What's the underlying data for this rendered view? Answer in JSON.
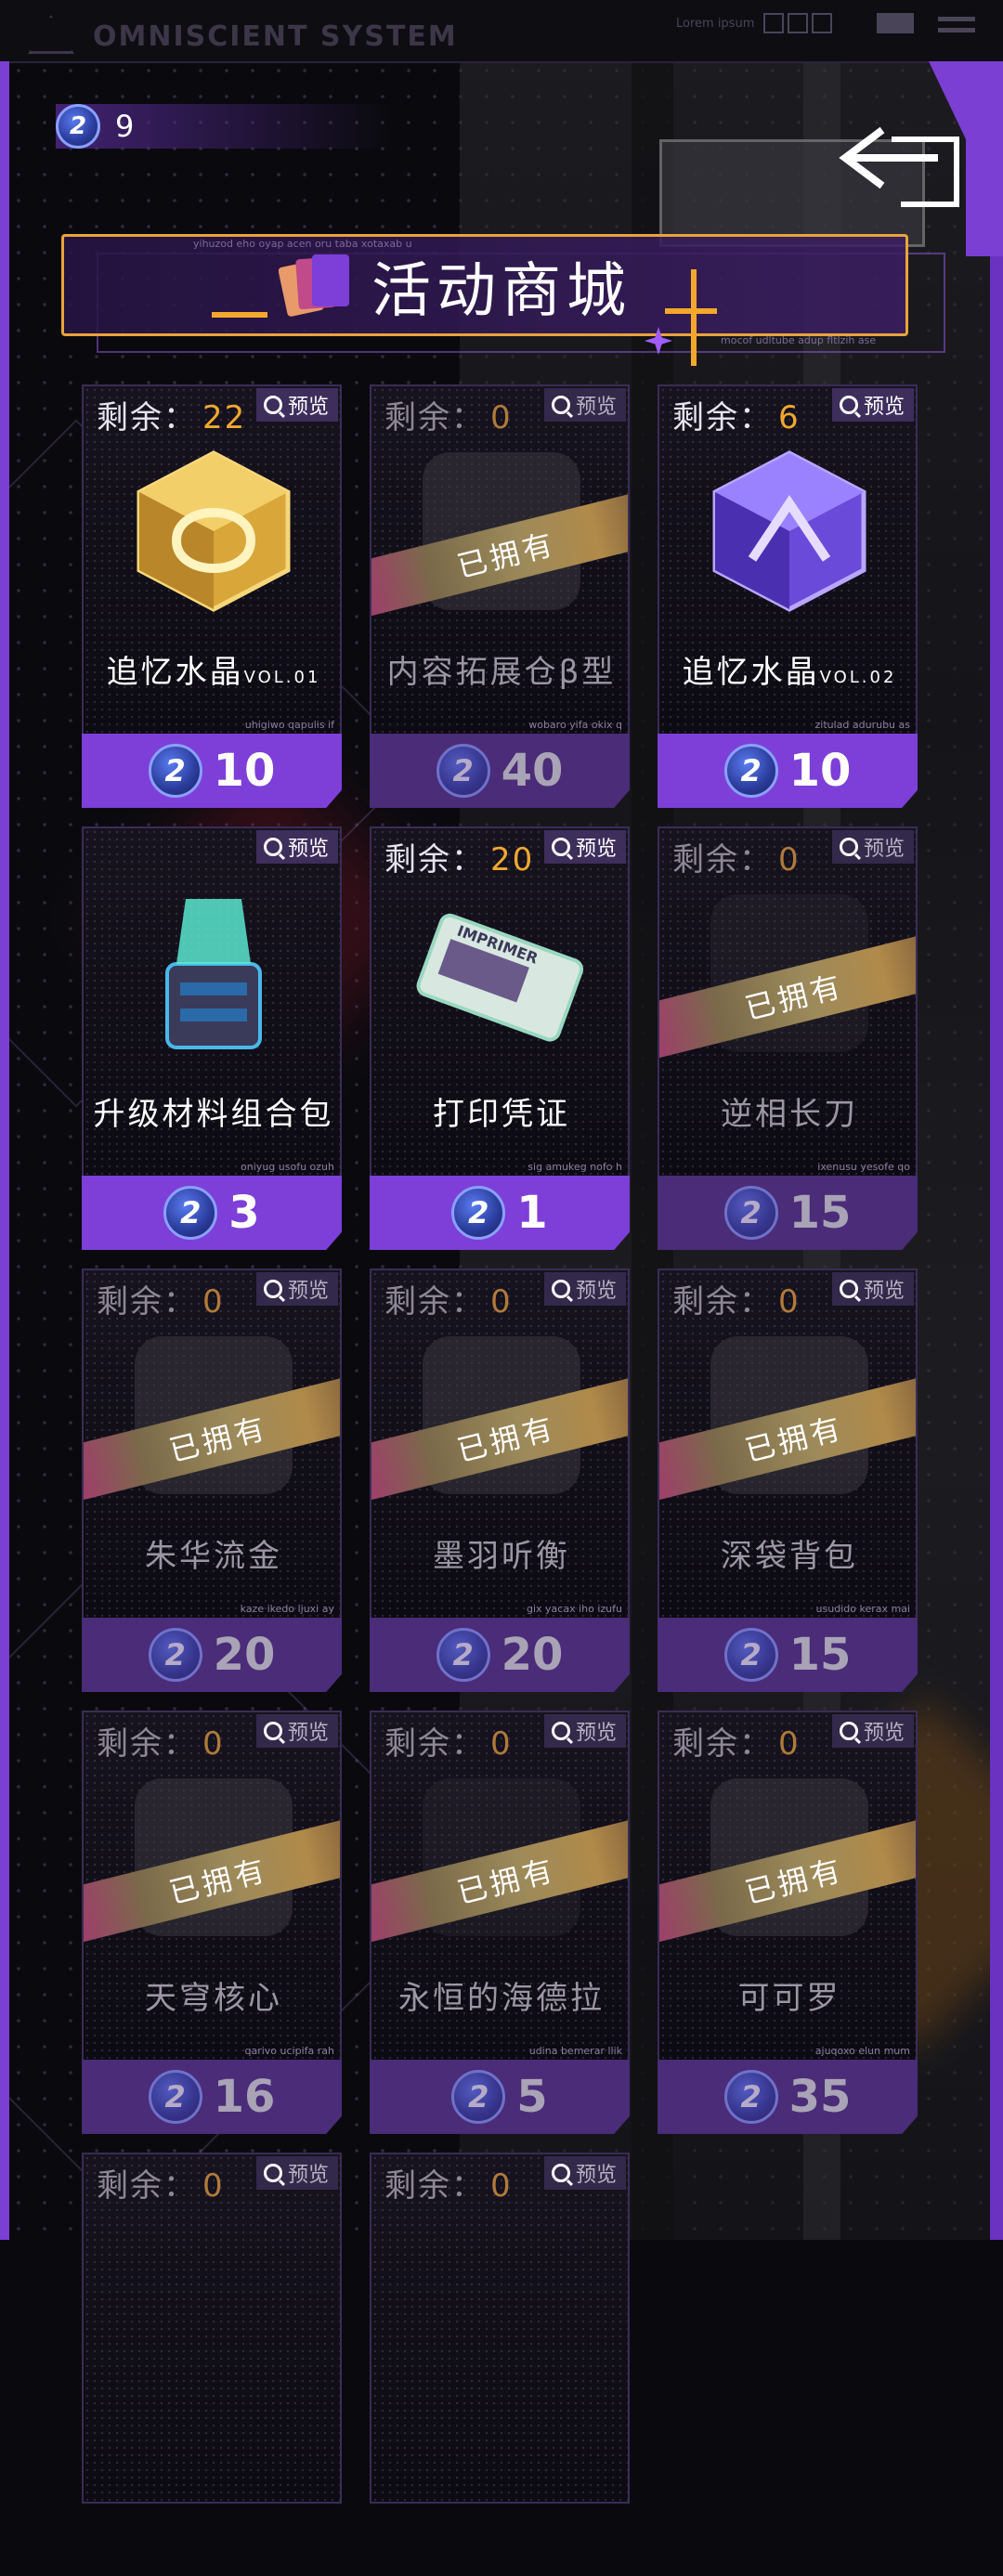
{
  "topbar": {
    "logo_text": "OMNISCIENT SYSTEM",
    "lorem": "Lorem ipsum"
  },
  "currency": {
    "icon": "gem-coin-icon",
    "amount": "9"
  },
  "title": {
    "text": "活动商城",
    "small_top": "yihuzod eho oyap acen oru taba xotaxab u",
    "small_bottom": "mocof udltube adup fltlzih ase"
  },
  "labels": {
    "remaining": "剩余：",
    "preview": "预览",
    "owned": "已拥有"
  },
  "items": [
    {
      "remaining": "22",
      "name": "追忆水晶",
      "vol": "VOL.01",
      "price": "10",
      "owned": false,
      "tiny": "uhigiwo qapulis if",
      "art": "gold-crystal-icon"
    },
    {
      "remaining": "0",
      "name": "内容拓展仓β型",
      "vol": "",
      "price": "40",
      "owned": true,
      "tiny": "wobaro yifa okix q",
      "art": "expansion-icon"
    },
    {
      "remaining": "6",
      "name": "追忆水晶",
      "vol": "VOL.02",
      "price": "10",
      "owned": false,
      "tiny": "zitulad adurubu as",
      "art": "purple-crystal-icon"
    },
    {
      "remaining": "",
      "name": "升级材料组合包",
      "vol": "",
      "price": "3",
      "owned": false,
      "tiny": "oniyug usofu ozuh",
      "art": "material-pack-icon"
    },
    {
      "remaining": "20",
      "name": "打印凭证",
      "vol": "",
      "price": "1",
      "owned": false,
      "tiny": "sig amukeg nofo h",
      "art": "ticket-icon"
    },
    {
      "remaining": "0",
      "name": "逆相长刀",
      "vol": "",
      "price": "15",
      "owned": true,
      "tiny": "ixenusu yesofe qo",
      "art": "blade-icon"
    },
    {
      "remaining": "0",
      "name": "朱华流金",
      "vol": "",
      "price": "20",
      "owned": true,
      "tiny": "kaze ikedo ljuxi ay",
      "art": "outfit-icon"
    },
    {
      "remaining": "0",
      "name": "墨羽听衡",
      "vol": "",
      "price": "20",
      "owned": true,
      "tiny": "gix yacax iho izufu",
      "art": "coat-icon"
    },
    {
      "remaining": "0",
      "name": "深袋背包",
      "vol": "",
      "price": "15",
      "owned": true,
      "tiny": "usudido kerax mai",
      "art": "backpack-icon"
    },
    {
      "remaining": "0",
      "name": "天穹核心",
      "vol": "",
      "price": "16",
      "owned": true,
      "tiny": "qarivo ucipifa rah",
      "art": "core-icon"
    },
    {
      "remaining": "0",
      "name": "永恒的海德拉",
      "vol": "",
      "price": "5",
      "owned": true,
      "tiny": "udina bemerar llik",
      "art": "hydra-icon"
    },
    {
      "remaining": "0",
      "name": "可可罗",
      "vol": "",
      "price": "35",
      "owned": true,
      "tiny": "ajuqoxo elun mum",
      "art": "robot-icon"
    },
    {
      "remaining": "0",
      "name": "",
      "vol": "",
      "price": "",
      "owned": true,
      "tiny": "",
      "art": ""
    },
    {
      "remaining": "0",
      "name": "",
      "vol": "",
      "price": "",
      "owned": true,
      "tiny": "",
      "art": ""
    }
  ],
  "colors": {
    "accent_purple": "#7d3fd8",
    "owned_purple": "#4a2c78",
    "remaining_orange": "#f0a830",
    "banner_border": "#e8a43a"
  }
}
